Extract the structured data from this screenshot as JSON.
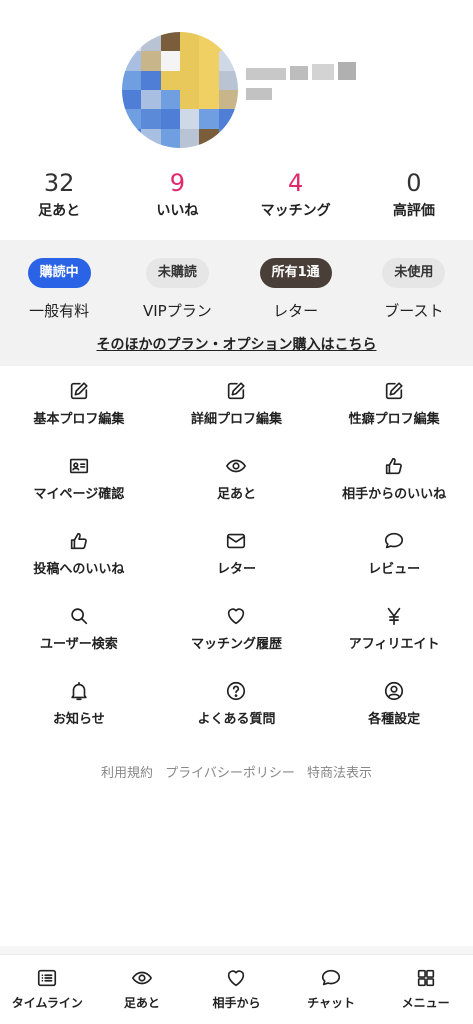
{
  "stats": [
    {
      "value": "32",
      "label": "足あと",
      "color": "#333333"
    },
    {
      "value": "9",
      "label": "いいね",
      "color": "#e0286a"
    },
    {
      "value": "4",
      "label": "マッチング",
      "color": "#e0286a"
    },
    {
      "value": "0",
      "label": "高評価",
      "color": "#333333"
    }
  ],
  "plans": [
    {
      "badge": "購読中",
      "label": "一般有料"
    },
    {
      "badge": "未購読",
      "label": "VIPプラン"
    },
    {
      "badge": "所有1通",
      "label": "レター"
    },
    {
      "badge": "未使用",
      "label": "ブースト"
    }
  ],
  "plan_link": "そのほかのプラン・オプション購入はこちら",
  "menu": [
    {
      "label": "基本プロフ編集",
      "icon": "edit-icon"
    },
    {
      "label": "詳細プロフ編集",
      "icon": "edit-icon"
    },
    {
      "label": "性癖プロフ編集",
      "icon": "edit-icon"
    },
    {
      "label": "マイページ確認",
      "icon": "id-card-icon"
    },
    {
      "label": "足あと",
      "icon": "eye-icon"
    },
    {
      "label": "相手からのいいね",
      "icon": "thumbs-up-icon"
    },
    {
      "label": "投稿へのいいね",
      "icon": "thumbs-up-icon"
    },
    {
      "label": "レター",
      "icon": "envelope-icon"
    },
    {
      "label": "レビュー",
      "icon": "chat-bubble-icon"
    },
    {
      "label": "ユーザー検索",
      "icon": "search-icon"
    },
    {
      "label": "マッチング履歴",
      "icon": "heart-icon"
    },
    {
      "label": "アフィリエイト",
      "icon": "yen-icon"
    },
    {
      "label": "お知らせ",
      "icon": "bell-icon"
    },
    {
      "label": "よくある質問",
      "icon": "question-icon"
    },
    {
      "label": "各種設定",
      "icon": "user-circle-icon"
    }
  ],
  "footer_links": [
    "利用規約",
    "プライバシーポリシー",
    "特商法表示"
  ],
  "bottom_nav": [
    {
      "label": "タイムライン",
      "icon": "list-icon"
    },
    {
      "label": "足あと",
      "icon": "eye-icon"
    },
    {
      "label": "相手から",
      "icon": "heart-icon"
    },
    {
      "label": "チャット",
      "icon": "chat-bubble-icon"
    },
    {
      "label": "メニュー",
      "icon": "grid-icon"
    }
  ],
  "colors": {
    "accent_blue": "#2b63e6",
    "accent_pink": "#e0286a",
    "badge_dark": "#4a3f38"
  }
}
